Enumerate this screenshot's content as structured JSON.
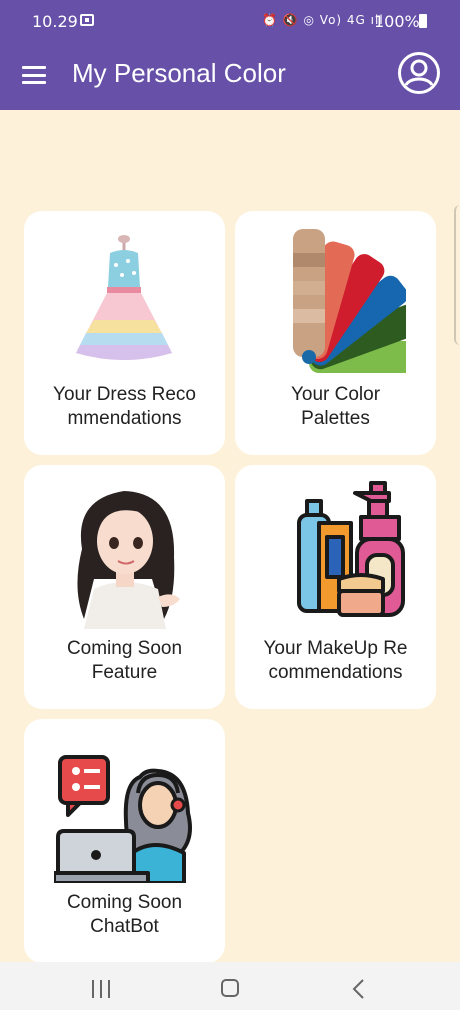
{
  "status_bar": {
    "time": "10.29",
    "indicators": "⏰ 🔇 ◎ Vo) 4G ıll",
    "battery": "100%",
    "icons": [
      "screencast-icon",
      "alarm-icon",
      "mute-icon",
      "hotspot-icon",
      "volte-icon",
      "signal-icon",
      "battery-icon"
    ]
  },
  "app_bar": {
    "title": "My Personal Color",
    "menu_icon": "menu-icon",
    "account_icon": "account-circle-icon",
    "color": "#6650a8"
  },
  "cards": [
    {
      "label": "Your Dress Reco\nmmendations",
      "icon": "dress-icon"
    },
    {
      "label": "Your Color\nPalettes",
      "icon": "color-palette-icon"
    },
    {
      "label": "Coming Soon\nFeature",
      "icon": "girl-avatar-icon"
    },
    {
      "label": "Your MakeUp Re\ncommendations",
      "icon": "makeup-icon"
    },
    {
      "label": "Coming Soon\nChatBot",
      "icon": "chatbot-agent-icon"
    }
  ],
  "nav_bar": {
    "icons": [
      "recent-apps-icon",
      "home-icon",
      "back-icon"
    ]
  },
  "colors": {
    "background": "#fdf1d9",
    "card": "#ffffff",
    "accent": "#6650a8"
  }
}
